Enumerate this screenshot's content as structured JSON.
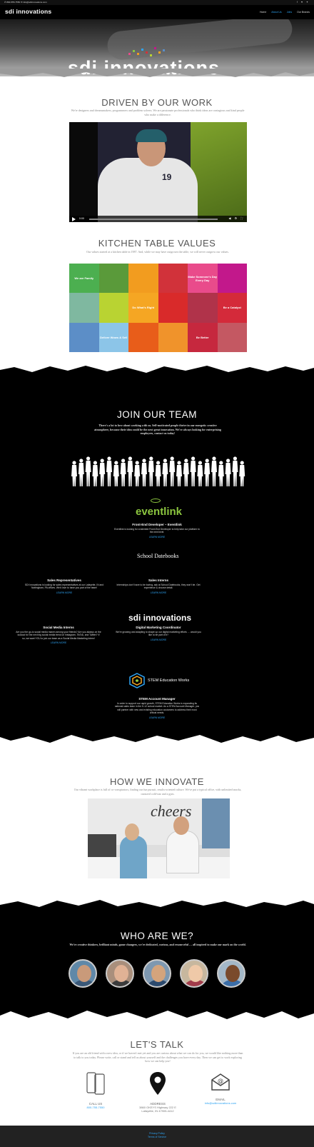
{
  "topbar": {
    "phone_email": "✆ 800-555-7550   ✉ info@sdiinnovations.com",
    "social": "f ♥ ✦"
  },
  "header": {
    "logo": "sdi innovations",
    "nav": [
      "Home",
      "About Us",
      "Jobs",
      "Our Brands"
    ],
    "active_nav": "About Us"
  },
  "hero": {
    "logo": "sdi  innovations"
  },
  "driven": {
    "title": "DRIVEN BY OUR WORK",
    "subtitle": "We're designers and dreamsmakers, programmers and problem solvers. We are passionate professionals who think ideas are contagious and kind people who make a difference.",
    "video": {
      "time": "0:00",
      "jersey": "19"
    }
  },
  "kitchen": {
    "title": "KITCHEN TABLE VALUES",
    "subtitle": "Our values started at a kitchen table in 1987. And, while we may have outgrown the table, we will never outgrow our values.",
    "cells": [
      {
        "label": "We are Family",
        "color": "#4caf50"
      },
      {
        "label": "",
        "color": "#5a9a3a"
      },
      {
        "label": "",
        "color": "#f29c1f"
      },
      {
        "label": "",
        "color": "#d1323a"
      },
      {
        "label": "Make Someone's Day Every Day",
        "color": "#e94b8b"
      },
      {
        "label": "",
        "color": "#c2188b"
      },
      {
        "label": "",
        "color": "#7fb8a0"
      },
      {
        "label": "",
        "color": "#b9d332"
      },
      {
        "label": "Do What's Right",
        "color": "#f5a623"
      },
      {
        "label": "",
        "color": "#d92a2a"
      },
      {
        "label": "",
        "color": "#b0334a"
      },
      {
        "label": "Be a Catalyst",
        "color": "#d42a3a"
      },
      {
        "label": "",
        "color": "#5c8ec7"
      },
      {
        "label": "Deliver Wows & Sell",
        "color": "#8cc5e8"
      },
      {
        "label": "",
        "color": "#e85d1a"
      },
      {
        "label": "",
        "color": "#f0932b"
      },
      {
        "label": "Be Better",
        "color": "#c6283e"
      },
      {
        "label": "",
        "color": "#c45862"
      }
    ]
  },
  "join": {
    "title": "JOIN OUR TEAM",
    "subtitle": "There's a lot to love about working with us. Self-motivated people thrive in our energetic creative atmosphere, because their idea could be the next great innovation. We're always looking for enterprising employees, contact us today!",
    "jobs": [
      {
        "id": "eventlink",
        "brand": "eventlink",
        "title": "Front-End Developer – Eventlink",
        "desc": "Eventlink is looking for a talented Front-End Developer to help take our platform to the next level.",
        "link": "LEARN MORE"
      },
      {
        "id": "sales",
        "title": "Sales Representatives",
        "desc": "SDI Innovations is looking for sales representatives at our Lafayette, IN and Nottingham, PA offices. We'd love to have you part of the team!",
        "link": "LEARN MORE"
      },
      {
        "id": "interns",
        "brand": "School Datebooks",
        "title": "Sales Interns",
        "desc": "Internships don't have to be boring, ask at School Datebooks, they won't be. Get experience & choose detail.",
        "link": "LEARN MORE"
      },
      {
        "id": "social",
        "title": "Social Media Interns",
        "desc": "Are you the go-to social media maven among your friends? Are you always on the lookout for the next big social media trend on Instagram, TikTok, and Twitter? If so, we want YOU to join our team as a Social Media Marketing Intern!",
        "link": "LEARN MORE"
      },
      {
        "id": "digital",
        "brand": "sdi innovations",
        "title": "Digital Marketing Coordinator",
        "desc": "We're growing and adapting to shape up our digital marketing efforts … would you like to be part of it?",
        "link": "LEARN MORE"
      },
      {
        "id": "stem",
        "brand": "STEM Education Works",
        "title": "STEM Account Manager",
        "desc": "In order to support our rapid growth, STEM Education Works is expanding its national sales team in the K-12 school market. As a STEM Account Manager, you will partner with new and existing education customers to address their most critical needs.",
        "link": "LEARN MORE"
      }
    ]
  },
  "innovate": {
    "title": "HOW WE INNOVATE",
    "subtitle": "Our vibrant workplace is full of co-conspirators, finding our fun pursuit, results-oriented culture. We've put a typical office, with unlimited snacks, outsized cold-star and a gym.",
    "video_text": "cheers"
  },
  "who": {
    "title": "WHO ARE WE?",
    "subtitle": "We're creative thinkers, brilliant minds, game changers, we're dedicated, curious, and resourceful … all inspired to make our mark on the world.",
    "people": [
      {
        "skin": "#c99a7a",
        "shirt": "#3a5878",
        "bg": "#5f88a8"
      },
      {
        "skin": "#e0b295",
        "shirt": "#3c3c3c",
        "bg": "#a98f7c"
      },
      {
        "skin": "#d4a47c",
        "shirt": "#2c4a6e",
        "bg": "#7e98b0"
      },
      {
        "skin": "#efc9a8",
        "shirt": "#a23c4b",
        "bg": "#c7b79e"
      },
      {
        "skin": "#7a4a2c",
        "shirt": "#3b6ea8",
        "bg": "#a4b8c8"
      }
    ]
  },
  "talk": {
    "title": "LET'S TALK",
    "subtitle": "If you are an old friend with a new idea, or if we haven't met yet and you are curious about what we can do for you, we would like nothing more than to talk to you today. Please write, call or stand and tell us about yourself and the challenges you have every day. Then we can get to work exploring how we can help you!",
    "call": {
      "label": "CALL US",
      "value": "800-755-7550"
    },
    "address": {
      "label": "ADDRESS",
      "value": "3860 OKEYS Highway 222 E\nLafayette, IN 47905-4412"
    },
    "email": {
      "label": "EMAIL",
      "value": "info@sdiinnovations.com"
    }
  },
  "footer": {
    "links": [
      "Privacy Policy",
      "Terms of Service"
    ]
  }
}
